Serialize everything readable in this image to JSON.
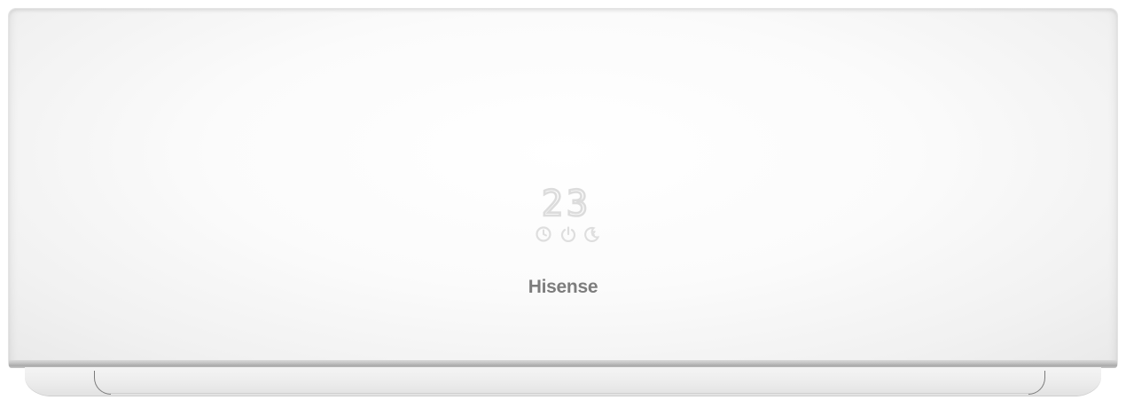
{
  "scene": {
    "subject": "split-air-conditioner-indoor-unit",
    "colors": {
      "body": "#f7f7f7",
      "trim": "#b8b8b8",
      "display": "#e6e6e6",
      "logo": "#7d7d7d"
    }
  },
  "display": {
    "temperature": "23",
    "icons": [
      "timer-icon",
      "power-icon",
      "sleep-icon"
    ]
  },
  "brand": {
    "name": "Hisense"
  }
}
